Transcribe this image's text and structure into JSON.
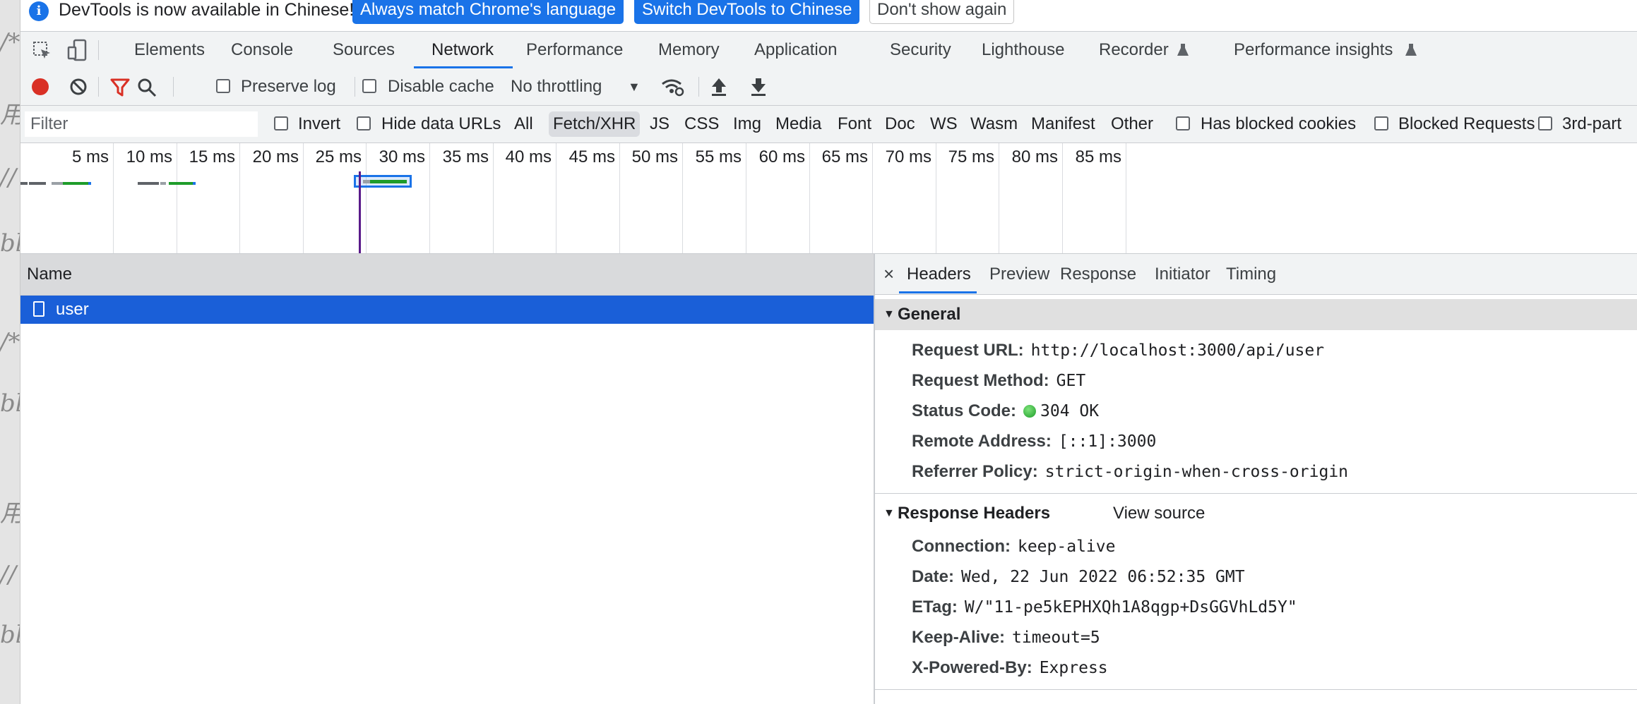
{
  "left_strip": {
    "fragments": [
      "/*",
      "",
      "//",
      "bl",
      "/*",
      "bl",
      "",
      "//",
      "bl"
    ]
  },
  "infobar": {
    "message": "DevTools is now available in Chinese!",
    "btn_match": "Always match Chrome's language",
    "btn_switch": "Switch DevTools to Chinese",
    "btn_dismiss": "Don't show again",
    "icon": "info-icon"
  },
  "tabs": [
    "Elements",
    "Console",
    "Sources",
    "Network",
    "Performance",
    "Memory",
    "Application",
    "Security",
    "Lighthouse",
    "Recorder",
    "Performance insights"
  ],
  "active_tab": "Network",
  "toolbar": {
    "preserve_log": "Preserve log",
    "disable_cache": "Disable cache",
    "throttling": "No throttling"
  },
  "filterbar": {
    "placeholder": "Filter",
    "invert": "Invert",
    "hide_data_urls": "Hide data URLs",
    "types": [
      "All",
      "Fetch/XHR",
      "JS",
      "CSS",
      "Img",
      "Media",
      "Font",
      "Doc",
      "WS",
      "Wasm",
      "Manifest",
      "Other"
    ],
    "active_type": "Fetch/XHR",
    "has_blocked_cookies": "Has blocked cookies",
    "blocked_requests": "Blocked Requests",
    "third_party": "3rd-part"
  },
  "overview": {
    "ticks": [
      "5 ms",
      "10 ms",
      "15 ms",
      "20 ms",
      "25 ms",
      "30 ms",
      "35 ms",
      "40 ms",
      "45 ms",
      "50 ms",
      "55 ms",
      "60 ms",
      "65 ms",
      "70 ms",
      "75 ms",
      "80 ms",
      "85 ms"
    ]
  },
  "list": {
    "header": "Name",
    "rows": [
      {
        "name": "user"
      }
    ]
  },
  "detail": {
    "tabs": [
      "Headers",
      "Preview",
      "Response",
      "Initiator",
      "Timing"
    ],
    "active_tab": "Headers",
    "general_title": "General",
    "general": [
      {
        "key": "Request URL:",
        "value": "http://localhost:3000/api/user"
      },
      {
        "key": "Request Method:",
        "value": "GET"
      },
      {
        "key": "Status Code:",
        "value": "304 OK"
      },
      {
        "key": "Remote Address:",
        "value": "[::1]:3000"
      },
      {
        "key": "Referrer Policy:",
        "value": "strict-origin-when-cross-origin"
      }
    ],
    "response_title": "Response Headers",
    "view_source": "View source",
    "response": [
      {
        "key": "Connection:",
        "value": "keep-alive"
      },
      {
        "key": "Date:",
        "value": "Wed, 22 Jun 2022 06:52:35 GMT"
      },
      {
        "key": "ETag:",
        "value": "W/\"11-pe5kEPHXQh1A8qgp+DsGGVhLd5Y\""
      },
      {
        "key": "Keep-Alive:",
        "value": "timeout=5"
      },
      {
        "key": "X-Powered-By:",
        "value": "Express"
      }
    ]
  },
  "colors": {
    "accent": "#1a73e8",
    "selected_row": "#1a5fd8",
    "record": "#d93025",
    "filter_active": "#d93025"
  }
}
